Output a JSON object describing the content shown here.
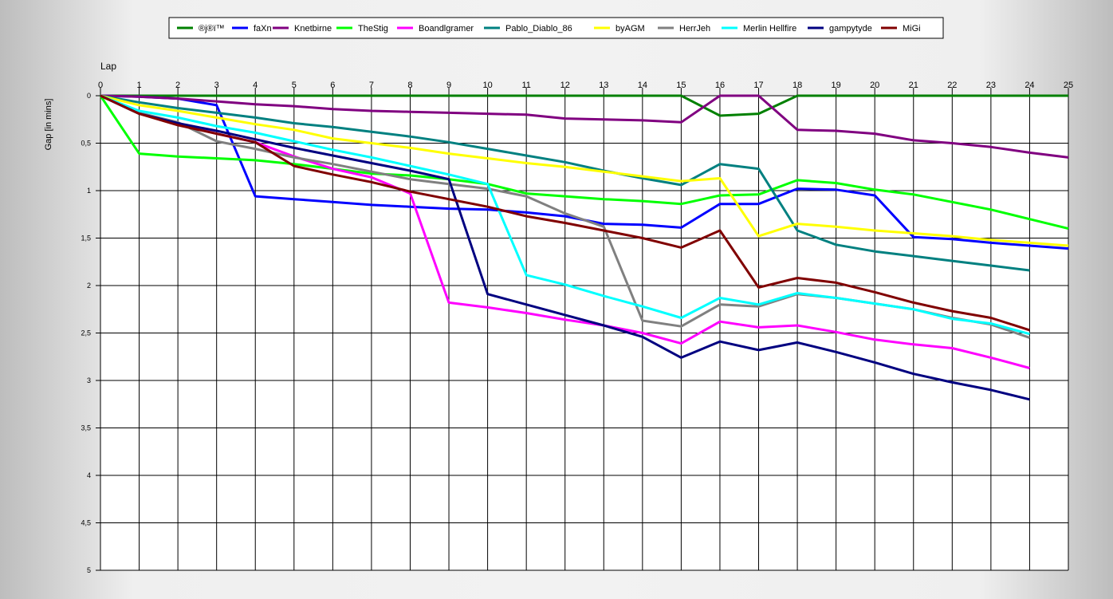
{
  "chart_data": {
    "type": "line",
    "xlabel": "Lap",
    "ylabel": "Gap [in mins]",
    "xlim": [
      0,
      25
    ],
    "ylim": [
      0,
      5
    ],
    "y_inverted": true,
    "grid": true,
    "legend_position": "top",
    "x_ticks": [
      "0",
      "1",
      "2",
      "3",
      "4",
      "5",
      "6",
      "7",
      "8",
      "9",
      "10",
      "11",
      "12",
      "13",
      "14",
      "15",
      "16",
      "17",
      "18",
      "19",
      "20",
      "21",
      "22",
      "23",
      "24",
      "25"
    ],
    "y_ticks": [
      {
        "value": 0,
        "label": "0"
      },
      {
        "value": 0.5,
        "label": "0,5"
      },
      {
        "value": 1,
        "label": "1"
      },
      {
        "value": 1.5,
        "label": "1,5"
      },
      {
        "value": 2,
        "label": "2"
      },
      {
        "value": 2.5,
        "label": "2,5"
      },
      {
        "value": 3,
        "label": "3"
      },
      {
        "value": 3.5,
        "label": "3,5"
      },
      {
        "value": 4,
        "label": "4"
      },
      {
        "value": 4.5,
        "label": "4,5"
      },
      {
        "value": 5,
        "label": "5"
      }
    ],
    "series": [
      {
        "name": "®j®ï™",
        "color": "#008000",
        "x": [
          0,
          1,
          2,
          3,
          4,
          5,
          6,
          7,
          8,
          9,
          10,
          11,
          12,
          13,
          14,
          15,
          16,
          17,
          18,
          19,
          20,
          21,
          22,
          23,
          24,
          25
        ],
        "y": [
          0,
          0,
          0,
          0,
          0,
          0,
          0,
          0,
          0,
          0,
          0,
          0,
          0,
          0,
          0,
          0,
          0.21,
          0.19,
          0,
          0,
          0,
          0,
          0,
          0,
          0,
          0
        ]
      },
      {
        "name": "faXn",
        "color": "#0000ff",
        "x": [
          0,
          1,
          2,
          3,
          4,
          5,
          6,
          7,
          8,
          9,
          10,
          11,
          12,
          13,
          14,
          15,
          16,
          17,
          18,
          19,
          20,
          21,
          22,
          23,
          24,
          25
        ],
        "y": [
          0,
          0.01,
          0.03,
          0.1,
          1.06,
          1.09,
          1.12,
          1.15,
          1.17,
          1.19,
          1.2,
          1.23,
          1.27,
          1.35,
          1.36,
          1.39,
          1.14,
          1.14,
          0.98,
          0.99,
          1.05,
          1.49,
          1.51,
          1.55,
          1.58,
          1.61
        ]
      },
      {
        "name": "Knetbirne",
        "color": "#800080",
        "x": [
          0,
          1,
          2,
          3,
          4,
          5,
          6,
          7,
          8,
          9,
          10,
          11,
          12,
          13,
          14,
          15,
          16,
          17,
          18,
          19,
          20,
          21,
          22,
          23,
          24,
          25
        ],
        "y": [
          0,
          0.01,
          0.03,
          0.06,
          0.09,
          0.11,
          0.14,
          0.16,
          0.17,
          0.18,
          0.19,
          0.2,
          0.24,
          0.25,
          0.26,
          0.28,
          0,
          0,
          0.36,
          0.37,
          0.4,
          0.47,
          0.5,
          0.54,
          0.6,
          0.65
        ]
      },
      {
        "name": "TheStig",
        "color": "#00ff00",
        "x": [
          0,
          1,
          2,
          3,
          4,
          5,
          6,
          7,
          8,
          9,
          10,
          11,
          12,
          13,
          14,
          15,
          16,
          17,
          18,
          19,
          20,
          21,
          22,
          23,
          24,
          25
        ],
        "y": [
          0,
          0.61,
          0.64,
          0.66,
          0.68,
          0.72,
          0.77,
          0.82,
          0.84,
          0.88,
          0.93,
          1.03,
          1.06,
          1.09,
          1.11,
          1.14,
          1.05,
          1.04,
          0.89,
          0.92,
          0.99,
          1.04,
          1.12,
          1.2,
          1.3,
          1.4
        ]
      },
      {
        "name": "Boandlgramer",
        "color": "#ff00ff",
        "x": [
          0,
          1,
          2,
          3,
          4,
          5,
          6,
          7,
          8,
          9,
          10,
          11,
          12,
          13,
          14,
          15,
          16,
          17,
          18,
          19,
          20,
          21,
          22,
          23,
          24
        ],
        "y": [
          0,
          0.18,
          0.3,
          0.4,
          0.49,
          0.64,
          0.77,
          0.86,
          1.03,
          2.18,
          2.23,
          2.29,
          2.36,
          2.42,
          2.5,
          2.61,
          2.38,
          2.44,
          2.42,
          2.49,
          2.57,
          2.62,
          2.66,
          2.76,
          2.87
        ]
      },
      {
        "name": "Pablo_Diablo_86",
        "color": "#008080",
        "x": [
          0,
          1,
          2,
          3,
          4,
          5,
          6,
          7,
          8,
          9,
          10,
          11,
          12,
          13,
          14,
          15,
          16,
          17,
          18,
          19,
          20,
          21,
          22,
          23,
          24
        ],
        "y": [
          0,
          0.07,
          0.13,
          0.18,
          0.23,
          0.29,
          0.33,
          0.38,
          0.43,
          0.49,
          0.56,
          0.63,
          0.7,
          0.79,
          0.87,
          0.94,
          0.72,
          0.77,
          1.42,
          1.57,
          1.64,
          1.69,
          1.74,
          1.79,
          1.84
        ]
      },
      {
        "name": "byAGM",
        "color": "#ffff00",
        "x": [
          0,
          1,
          2,
          3,
          4,
          5,
          6,
          7,
          8,
          9,
          10,
          11,
          12,
          13,
          14,
          15,
          16,
          17,
          18,
          19,
          20,
          21,
          22,
          23,
          24,
          25
        ],
        "y": [
          0,
          0.1,
          0.16,
          0.23,
          0.3,
          0.36,
          0.45,
          0.5,
          0.55,
          0.61,
          0.66,
          0.71,
          0.75,
          0.8,
          0.85,
          0.9,
          0.87,
          1.48,
          1.35,
          1.38,
          1.42,
          1.45,
          1.48,
          1.52,
          1.55,
          1.58
        ]
      },
      {
        "name": "HerrJeh",
        "color": "#808080",
        "x": [
          0,
          1,
          2,
          3,
          4,
          5,
          6,
          7,
          8,
          9,
          10,
          11,
          12,
          13,
          14,
          15,
          16,
          17,
          18,
          19,
          20,
          21,
          22,
          23,
          24
        ],
        "y": [
          0,
          0.18,
          0.28,
          0.48,
          0.56,
          0.65,
          0.72,
          0.8,
          0.88,
          0.93,
          0.98,
          1.06,
          1.24,
          1.38,
          2.37,
          2.43,
          2.2,
          2.22,
          2.09,
          2.13,
          2.19,
          2.25,
          2.34,
          2.41,
          2.55
        ]
      },
      {
        "name": "Merlin Hellfire",
        "color": "#00ffff",
        "x": [
          0,
          1,
          2,
          3,
          4,
          5,
          6,
          7,
          8,
          9,
          10,
          11,
          12,
          13,
          14,
          15,
          16,
          17,
          18,
          19,
          20,
          21,
          22,
          23,
          24
        ],
        "y": [
          0,
          0.16,
          0.23,
          0.32,
          0.39,
          0.48,
          0.57,
          0.65,
          0.74,
          0.83,
          0.93,
          1.89,
          1.99,
          2.11,
          2.22,
          2.34,
          2.13,
          2.2,
          2.08,
          2.13,
          2.19,
          2.25,
          2.35,
          2.4,
          2.51
        ]
      },
      {
        "name": "gampytyde",
        "color": "#000080",
        "x": [
          0,
          1,
          2,
          3,
          4,
          5,
          6,
          7,
          8,
          9,
          10,
          11,
          12,
          13,
          14,
          15,
          16,
          17,
          18,
          19,
          20,
          21,
          22,
          23,
          24
        ],
        "y": [
          0,
          0.19,
          0.29,
          0.37,
          0.46,
          0.55,
          0.63,
          0.71,
          0.79,
          0.88,
          2.09,
          2.2,
          2.31,
          2.42,
          2.54,
          2.76,
          2.59,
          2.68,
          2.6,
          2.7,
          2.81,
          2.93,
          3.02,
          3.1,
          3.2
        ]
      },
      {
        "name": "MiGi",
        "color": "#800000",
        "x": [
          0,
          1,
          2,
          3,
          4,
          5,
          6,
          7,
          8,
          9,
          10,
          11,
          12,
          13,
          14,
          15,
          16,
          17,
          18,
          19,
          20,
          21,
          22,
          23,
          24
        ],
        "y": [
          0,
          0.19,
          0.31,
          0.4,
          0.49,
          0.74,
          0.83,
          0.91,
          1.01,
          1.09,
          1.17,
          1.27,
          1.34,
          1.42,
          1.5,
          1.6,
          1.42,
          2.02,
          1.92,
          1.97,
          2.07,
          2.18,
          2.27,
          2.34,
          2.47
        ]
      }
    ]
  }
}
